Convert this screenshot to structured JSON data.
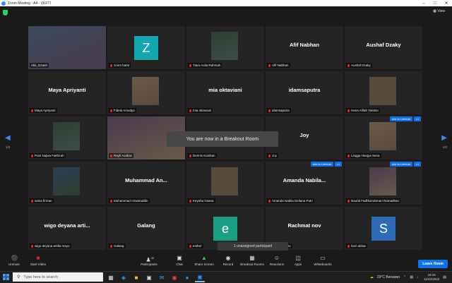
{
  "window": {
    "title": "Zoom Meeting - A4 - VKFTI"
  },
  "topbar": {
    "view_label": "View"
  },
  "tiles": [
    {
      "id": "alie-dzaen",
      "display": "video",
      "label": "Alie_Dzaen",
      "bigname": "",
      "active": true,
      "muted": false
    },
    {
      "id": "zoom-ba04",
      "display": "avatar",
      "initial": "Z",
      "avatar_color": "#13a7b0",
      "label": "zoom ba04",
      "bigname": "",
      "muted": true
    },
    {
      "id": "tiara",
      "display": "video",
      "label": "Tiara Aulia Rahmah",
      "bigname": "",
      "muted": true
    },
    {
      "id": "afif",
      "display": "name",
      "label": "Afif Nabhan",
      "bigname": "Afif Nabhan",
      "muted": true
    },
    {
      "id": "aushaf",
      "display": "name",
      "label": "Aushaf Dzaky",
      "bigname": "Aushaf Dzaky",
      "muted": true
    },
    {
      "id": "maya",
      "display": "name",
      "label": "Maya Apriyanti",
      "bigname": "Maya Apriyanti",
      "muted": true
    },
    {
      "id": "fidela",
      "display": "video",
      "label": "Fidela Amodya",
      "bigname": "",
      "muted": true
    },
    {
      "id": "mia",
      "display": "name",
      "label": "mia oktaviani",
      "bigname": "mia oktaviani",
      "muted": true
    },
    {
      "id": "idamsaputra",
      "display": "name",
      "label": "idamsaputra",
      "bigname": "idamsaputra",
      "muted": true
    },
    {
      "id": "hana",
      "display": "video",
      "label": "Hana Alifah Yasmin",
      "bigname": "",
      "muted": true
    },
    {
      "id": "putri",
      "display": "video",
      "label": "Putri Najwa Fakhirah",
      "bigname": "",
      "muted": true
    },
    {
      "id": "rayi",
      "display": "video",
      "label": "Rayfi Azahra",
      "bigname": "",
      "muted": true
    },
    {
      "id": "dennis",
      "display": "name",
      "label": "Dennis Kaishan",
      "bigname": "",
      "muted": true
    },
    {
      "id": "joy",
      "display": "name",
      "label": "Joy",
      "bigname": "Joy",
      "muted": true
    },
    {
      "id": "lingga",
      "display": "video",
      "label": "Lingga Hanjya Sena",
      "bigname": "",
      "muted": true,
      "ask": "Ask to Unmute",
      "dots": "•••"
    },
    {
      "id": "sania",
      "display": "video",
      "label": "sania firman",
      "bigname": "",
      "muted": true
    },
    {
      "id": "muhammad",
      "display": "name",
      "label": "Muhammad Anwaruddin",
      "bigname": "Muhammad An...",
      "muted": true
    },
    {
      "id": "keysha",
      "display": "video",
      "label": "Keysha Oxana",
      "bigname": "",
      "muted": true
    },
    {
      "id": "amanda",
      "display": "name",
      "label": "Amanda Nabila Deliana Putri",
      "bigname": "Amanda Nabila...",
      "muted": true,
      "ask": "Ask to Unmute",
      "dots": "•••"
    },
    {
      "id": "naufal",
      "display": "video",
      "label": "Naufal Fadhlurrahman Ramadhan",
      "bigname": "",
      "muted": true,
      "ask": "Ask to Unmute",
      "dots": "•••"
    },
    {
      "id": "wigo",
      "display": "name",
      "label": "wigo deyana artilla mayo",
      "bigname": "wigo deyana arti...",
      "muted": true
    },
    {
      "id": "galang",
      "display": "name",
      "label": "Galang",
      "bigname": "Galang",
      "muted": true
    },
    {
      "id": "esther",
      "display": "avatar",
      "initial": "e",
      "avatar_color": "#1a9e84",
      "label": "esther",
      "bigname": "",
      "muted": true
    },
    {
      "id": "rachmat",
      "display": "name",
      "label": "Rachmat nov",
      "bigname": "Rachmat nov",
      "muted": true
    },
    {
      "id": "fazri",
      "display": "avatar",
      "initial": "S",
      "avatar_color": "#2e6ab5",
      "label": "fazri akbar",
      "bigname": "",
      "muted": true
    }
  ],
  "toast": "You are now in a Breakout Room",
  "unassigned": "1 unassigned participant",
  "pager": {
    "left": "1/2",
    "right": "1/2"
  },
  "toolbar": {
    "unmute": "Unmute",
    "video": "Start Video",
    "participants": "Participants",
    "participants_count": "30",
    "chat": "Chat",
    "share": "Share Screen",
    "record": "Record",
    "breakout": "Breakout Rooms",
    "reactions": "Reactions",
    "apps": "Apps",
    "whiteboards": "Whiteboards",
    "leave": "Leave Room"
  },
  "taskbar": {
    "search_placeholder": "Type here to search",
    "weather": "29°C  Berawan",
    "time": "19:15",
    "date": "11/22/2022"
  },
  "colors": {
    "accent": "#0e72ed",
    "active_speaker": "#d6e34a",
    "muted_mic": "#e0262b"
  }
}
